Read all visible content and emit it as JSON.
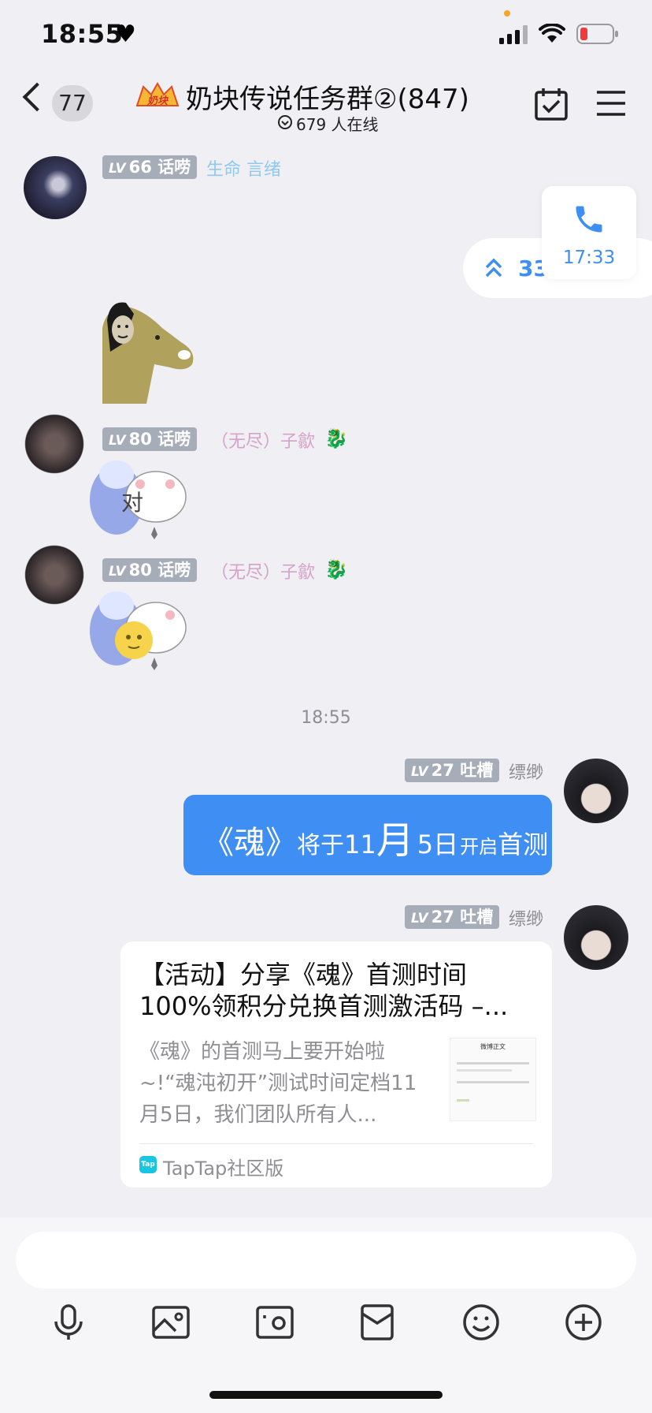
{
  "status": {
    "time": "18:55"
  },
  "header": {
    "unread_count": "77",
    "group_name": "奶块传说任务群②(847)",
    "online_text": "679 人在线",
    "logo_text": "奶块"
  },
  "float": {
    "call_time": "17:33",
    "jump_count": "33"
  },
  "messages": [
    {
      "level": "66",
      "rank": "话唠",
      "name": "生命 言绪"
    },
    {
      "level": "80",
      "rank": "话唠",
      "name": "（无尽）子歙",
      "sticker_text": "对"
    },
    {
      "level": "80",
      "rank": "话唠",
      "name": "（无尽）子歙"
    }
  ],
  "divider_time": "18:55",
  "self": {
    "level": "27",
    "rank": "吐槽",
    "name": "缥缈",
    "text_parts": [
      "《魂》",
      "将于",
      "11",
      "月",
      "5日",
      "开启",
      "首测"
    ]
  },
  "share_card": {
    "level": "27",
    "rank": "吐槽",
    "name": "缥缈",
    "title": "【活动】分享《魂》首测时间100%领积分兑换首测激活码 –...",
    "desc": "《魂》的首测马上要开始啦~!“魂沌初开”测试时间定档11月5日，我们团队所有人...",
    "thumb_title": "微博正文",
    "source": "TapTap社区版",
    "source_icon_text": "Tap"
  },
  "colors": {
    "accent": "#3f8ef3",
    "badge": "#a7acb9",
    "name_pink": "#d6a3c8",
    "name_cyan": "#8fc9ec",
    "background": "#efeff4"
  }
}
